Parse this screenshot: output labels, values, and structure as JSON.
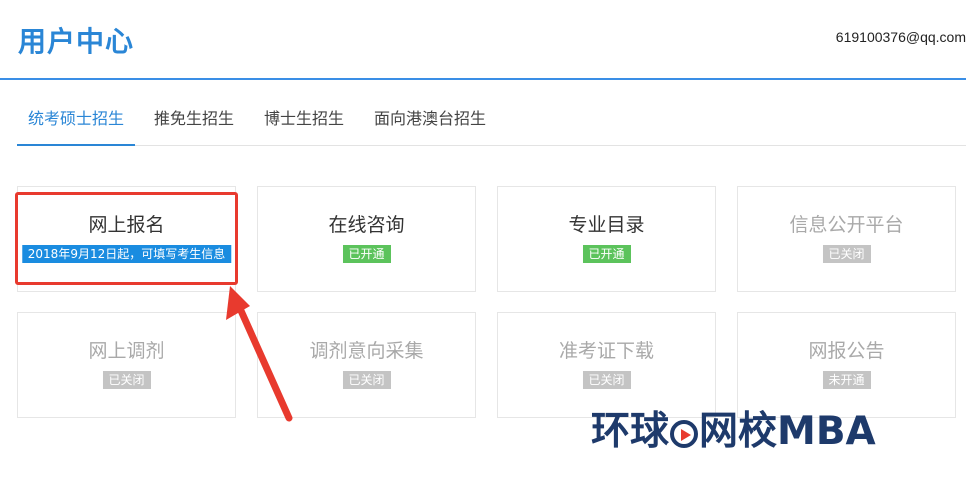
{
  "header": {
    "title": "用户中心",
    "user_email": "619100376@qq.com"
  },
  "tabs": [
    {
      "label": "统考硕士招生",
      "active": true
    },
    {
      "label": "推免生招生",
      "active": false
    },
    {
      "label": "博士生招生",
      "active": false
    },
    {
      "label": "面向港澳台招生",
      "active": false
    }
  ],
  "cards": [
    {
      "name": "网上报名",
      "badge": "2018年9月12日起，可填写考生信息",
      "badge_color": "#1a8ce0",
      "status": "open"
    },
    {
      "name": "在线咨询",
      "badge": "已开通",
      "badge_color": "#5cc35c",
      "status": "open"
    },
    {
      "name": "专业目录",
      "badge": "已开通",
      "badge_color": "#5cc35c",
      "status": "open"
    },
    {
      "name": "信息公开平台",
      "badge": "已关闭",
      "badge_color": "#c4c4c4",
      "status": "closed"
    },
    {
      "name": "网上调剂",
      "badge": "已关闭",
      "badge_color": "#c4c4c4",
      "status": "closed"
    },
    {
      "name": "调剂意向采集",
      "badge": "已关闭",
      "badge_color": "#c4c4c4",
      "status": "closed"
    },
    {
      "name": "准考证下载",
      "badge": "已关闭",
      "badge_color": "#c4c4c4",
      "status": "closed"
    },
    {
      "name": "网报公告",
      "badge": "未开通",
      "badge_color": "#c4c4c4",
      "status": "closed"
    }
  ],
  "annotation": {
    "color": "#e83a2e"
  },
  "watermark": {
    "part1": "环球",
    "part2": "网校MBA"
  }
}
